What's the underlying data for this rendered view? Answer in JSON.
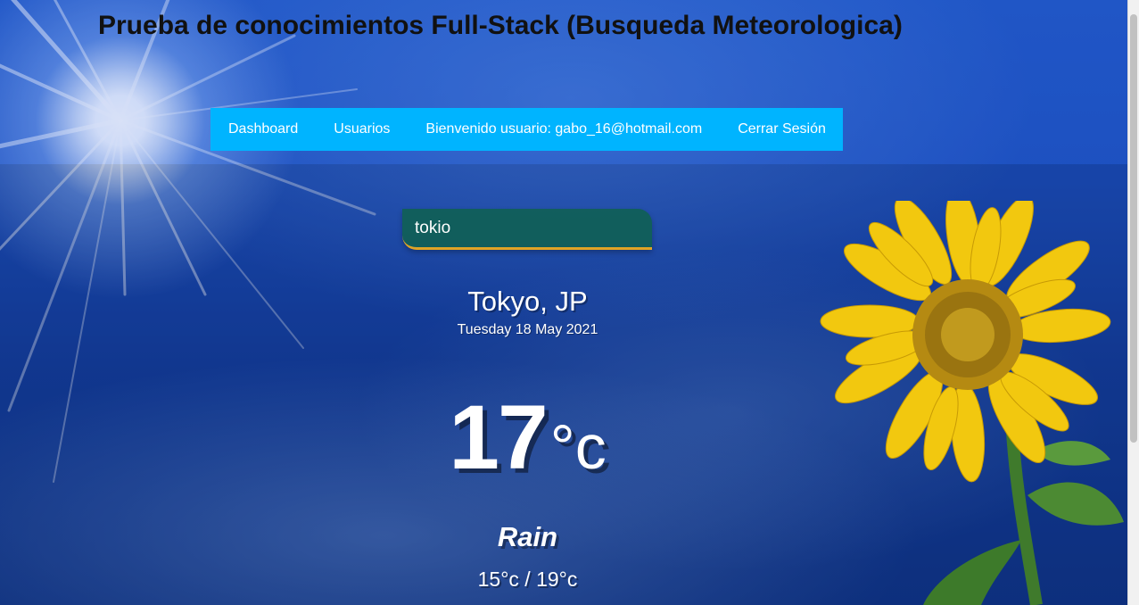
{
  "header": {
    "title": "Prueba de conocimientos Full-Stack (Busqueda Meteorologica)"
  },
  "nav": {
    "items": [
      {
        "label": "Dashboard"
      },
      {
        "label": "Usuarios"
      },
      {
        "label": "Bienvenido usuario: gabo_16@hotmail.com"
      },
      {
        "label": "Cerrar Sesión"
      }
    ]
  },
  "search": {
    "value": "tokio",
    "placeholder": ""
  },
  "weather": {
    "location": "Tokyo, JP",
    "date": "Tuesday 18 May 2021",
    "temperature": "17",
    "unit": "°c",
    "condition": "Rain",
    "range": "15°c / 19°c"
  },
  "colors": {
    "nav_background": "#00b4ff",
    "search_background": "#106056",
    "search_underline": "#dfa326",
    "sky": "#1c4fbd"
  }
}
